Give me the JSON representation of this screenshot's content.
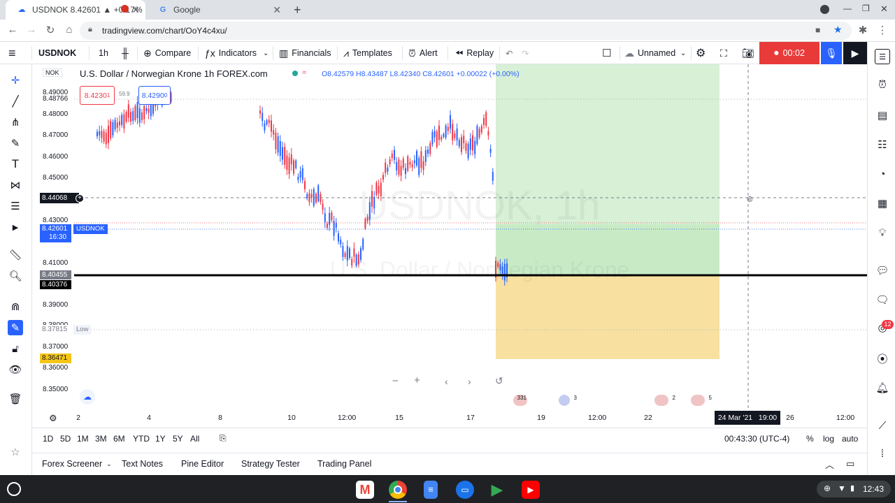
{
  "browser": {
    "tabs": [
      {
        "title": "USDNOK 8.42601 ▲ +0.17%",
        "active": true
      },
      {
        "title": "Google",
        "active": false
      }
    ],
    "url": "tradingview.com/chart/OoY4c4xu/"
  },
  "toolbar": {
    "symbol": "USDNOK",
    "interval": "1h",
    "compare": "Compare",
    "indicators": "Indicators",
    "financials": "Financials",
    "templates": "Templates",
    "alert": "Alert",
    "replay": "Replay",
    "layout_name": "Unnamed",
    "record_time": "00:02"
  },
  "chart": {
    "title": "U.S. Dollar / Norwegian Krone  1h  FOREX.com",
    "ohlc": "O8.42579 H8.43487 L8.42340 C8.42601 +0.00022 (+0.00%)",
    "currency": "NOK",
    "sell_price": "8.4230",
    "sell_sup": "1",
    "spread": "59.9",
    "buy_price": "8.4290",
    "buy_sup": "0",
    "watermark_symbol": "USDNOK, 1h",
    "watermark_name": "U.S. Dollar / Norwegian Krone",
    "price_labels": [
      "8.49000",
      "8.48000",
      "8.47000",
      "8.46000",
      "8.45000",
      "8.43000",
      "8.41000",
      "8.39000",
      "8.38000",
      "8.37000",
      "8.36000",
      "8.35000"
    ],
    "marker_labels": {
      "top": "8.48766",
      "cursor": "8.44068",
      "last": "8.42601",
      "last_time": "16:30",
      "last_tag": "USDNOK",
      "line1": "8.40455",
      "line2": "8.40376",
      "low": "8.37815",
      "low_tag": "Low",
      "target": "8.36471"
    },
    "time_labels": [
      "2",
      "4",
      "8",
      "10",
      "12:00",
      "15",
      "17",
      "19",
      "12:00",
      "22",
      "26",
      "12:00"
    ],
    "crosshair_time": "24 Mar '21   19:00",
    "events": [
      "331",
      "3",
      "2",
      "5"
    ]
  },
  "bottom": {
    "ranges": [
      "1D",
      "5D",
      "1M",
      "3M",
      "6M",
      "YTD",
      "1Y",
      "5Y",
      "All"
    ],
    "clock": "00:43:30 (UTC-4)",
    "percent": "%",
    "log": "log",
    "auto": "auto",
    "panels": [
      "Forex Screener",
      "Text Notes",
      "Pine Editor",
      "Strategy Tester",
      "Trading Panel"
    ]
  },
  "notification_count": "12",
  "system_time": "12:43",
  "colors": {
    "accent": "#2962ff",
    "up": "#2962ff",
    "down": "#f23645",
    "record": "#e93a3a",
    "profit_zone": "#c8ebc6",
    "loss_zone": "#f7e0a0"
  }
}
